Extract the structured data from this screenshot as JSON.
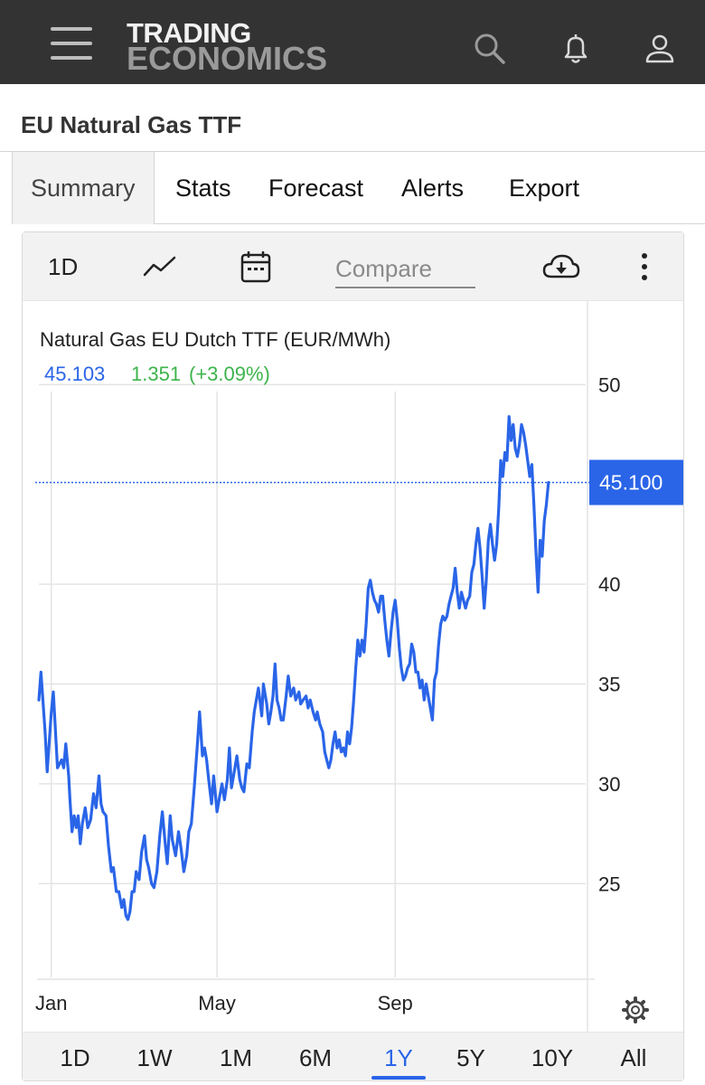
{
  "header": {
    "logo_line1": "TRADING",
    "logo_line2": "ECONOMICS",
    "icons": [
      "menu-icon",
      "search-icon",
      "bell-icon",
      "user-icon"
    ]
  },
  "page": {
    "title": "EU Natural Gas TTF"
  },
  "tabs": [
    {
      "label": "Summary",
      "active": true
    },
    {
      "label": "Stats"
    },
    {
      "label": "Forecast"
    },
    {
      "label": "Alerts"
    },
    {
      "label": "Export"
    }
  ],
  "toolbar": {
    "interval_label": "1D",
    "compare_placeholder": "Compare",
    "icons": [
      "line-chart-icon",
      "calendar-icon",
      "cloud-download-icon",
      "more-vertical-icon"
    ]
  },
  "periods": [
    {
      "label": "1D"
    },
    {
      "label": "1W"
    },
    {
      "label": "1M"
    },
    {
      "label": "6M"
    },
    {
      "label": "1Y",
      "active": true
    },
    {
      "label": "5Y"
    },
    {
      "label": "10Y"
    },
    {
      "label": "All"
    }
  ],
  "colors": {
    "line": "#2a65e8",
    "change_positive": "#3cb44b",
    "header_bg": "#333333",
    "price_badge": "#2a65e8"
  },
  "chart_data": {
    "type": "line",
    "title": "Natural Gas EU Dutch TTF (EUR/MWh)",
    "last_value": "45.103",
    "change": "1.351",
    "change_pct": "(+3.09%)",
    "price_label": "45.100",
    "price_line_value": 45.1,
    "y_ticks": [
      25,
      30,
      35,
      40,
      50
    ],
    "ylim": [
      20.3,
      50.2
    ],
    "x_ticks": [
      {
        "label": "Jan",
        "x": 0.3
      },
      {
        "label": "May",
        "x": 4.3
      },
      {
        "label": "Sep",
        "x": 8.6
      }
    ],
    "xlim": [
      0,
      13.2
    ],
    "grid": true,
    "series": [
      {
        "points": [
          [
            0.0,
            34.2
          ],
          [
            0.05,
            35.6
          ],
          [
            0.15,
            32.6
          ],
          [
            0.2,
            30.6
          ],
          [
            0.3,
            33.6
          ],
          [
            0.35,
            34.6
          ],
          [
            0.45,
            30.8
          ],
          [
            0.55,
            31.2
          ],
          [
            0.6,
            30.8
          ],
          [
            0.65,
            32.0
          ],
          [
            0.72,
            30.4
          ],
          [
            0.75,
            29.2
          ],
          [
            0.8,
            27.6
          ],
          [
            0.85,
            28.4
          ],
          [
            0.9,
            27.8
          ],
          [
            0.95,
            28.4
          ],
          [
            1.0,
            27.0
          ],
          [
            1.05,
            28.0
          ],
          [
            1.12,
            28.8
          ],
          [
            1.18,
            27.8
          ],
          [
            1.25,
            28.2
          ],
          [
            1.32,
            29.5
          ],
          [
            1.38,
            28.8
          ],
          [
            1.45,
            30.4
          ],
          [
            1.5,
            29.0
          ],
          [
            1.55,
            28.6
          ],
          [
            1.62,
            28.4
          ],
          [
            1.68,
            26.9
          ],
          [
            1.75,
            25.6
          ],
          [
            1.8,
            25.8
          ],
          [
            1.87,
            24.6
          ],
          [
            1.93,
            24.6
          ],
          [
            2.0,
            23.8
          ],
          [
            2.05,
            24.2
          ],
          [
            2.1,
            23.4
          ],
          [
            2.15,
            23.2
          ],
          [
            2.2,
            23.6
          ],
          [
            2.25,
            24.6
          ],
          [
            2.3,
            24.6
          ],
          [
            2.35,
            25.6
          ],
          [
            2.42,
            25.2
          ],
          [
            2.48,
            26.6
          ],
          [
            2.55,
            27.4
          ],
          [
            2.6,
            26.2
          ],
          [
            2.65,
            25.8
          ],
          [
            2.72,
            25.0
          ],
          [
            2.78,
            24.8
          ],
          [
            2.85,
            25.6
          ],
          [
            2.92,
            27.4
          ],
          [
            2.98,
            28.6
          ],
          [
            3.05,
            27.0
          ],
          [
            3.1,
            26.0
          ],
          [
            3.17,
            28.4
          ],
          [
            3.22,
            27.2
          ],
          [
            3.3,
            26.4
          ],
          [
            3.37,
            27.6
          ],
          [
            3.43,
            26.8
          ],
          [
            3.5,
            25.6
          ],
          [
            3.57,
            26.4
          ],
          [
            3.62,
            27.6
          ],
          [
            3.68,
            28.0
          ],
          [
            3.75,
            29.8
          ],
          [
            3.82,
            31.8
          ],
          [
            3.88,
            33.6
          ],
          [
            3.95,
            31.4
          ],
          [
            4.0,
            31.8
          ],
          [
            4.05,
            31.2
          ],
          [
            4.1,
            30.2
          ],
          [
            4.17,
            29.0
          ],
          [
            4.22,
            30.4
          ],
          [
            4.3,
            28.6
          ],
          [
            4.35,
            29.2
          ],
          [
            4.42,
            30.0
          ],
          [
            4.48,
            29.2
          ],
          [
            4.55,
            30.2
          ],
          [
            4.6,
            31.8
          ],
          [
            4.65,
            29.8
          ],
          [
            4.7,
            30.4
          ],
          [
            4.78,
            31.4
          ],
          [
            4.85,
            30.2
          ],
          [
            4.9,
            29.8
          ],
          [
            4.95,
            29.6
          ],
          [
            5.02,
            31.0
          ],
          [
            5.08,
            30.8
          ],
          [
            5.15,
            32.6
          ],
          [
            5.2,
            33.6
          ],
          [
            5.25,
            34.2
          ],
          [
            5.3,
            34.8
          ],
          [
            5.38,
            33.4
          ],
          [
            5.42,
            35.0
          ],
          [
            5.5,
            34.0
          ],
          [
            5.55,
            33.0
          ],
          [
            5.6,
            33.6
          ],
          [
            5.65,
            34.4
          ],
          [
            5.7,
            36.0
          ],
          [
            5.75,
            34.2
          ],
          [
            5.8,
            33.8
          ],
          [
            5.85,
            33.2
          ],
          [
            5.9,
            33.2
          ],
          [
            5.97,
            34.4
          ],
          [
            6.02,
            35.4
          ],
          [
            6.08,
            34.4
          ],
          [
            6.15,
            34.8
          ],
          [
            6.2,
            34.2
          ],
          [
            6.28,
            34.6
          ],
          [
            6.32,
            34.0
          ],
          [
            6.38,
            34.2
          ],
          [
            6.45,
            34.4
          ],
          [
            6.5,
            33.8
          ],
          [
            6.55,
            34.2
          ],
          [
            6.62,
            33.6
          ],
          [
            6.68,
            33.2
          ],
          [
            6.72,
            33.6
          ],
          [
            6.78,
            33.0
          ],
          [
            6.85,
            32.6
          ],
          [
            6.9,
            31.6
          ],
          [
            6.95,
            31.2
          ],
          [
            7.0,
            30.8
          ],
          [
            7.05,
            31.2
          ],
          [
            7.1,
            32.0
          ],
          [
            7.15,
            32.6
          ],
          [
            7.2,
            31.8
          ],
          [
            7.25,
            32.2
          ],
          [
            7.3,
            31.6
          ],
          [
            7.35,
            31.8
          ],
          [
            7.4,
            31.4
          ],
          [
            7.45,
            32.6
          ],
          [
            7.5,
            32.0
          ],
          [
            7.55,
            32.8
          ],
          [
            7.6,
            34.2
          ],
          [
            7.65,
            35.8
          ],
          [
            7.7,
            37.2
          ],
          [
            7.75,
            36.4
          ],
          [
            7.8,
            37.2
          ],
          [
            7.85,
            36.6
          ],
          [
            7.9,
            38.0
          ],
          [
            7.95,
            39.8
          ],
          [
            8.0,
            40.2
          ],
          [
            8.05,
            39.6
          ],
          [
            8.1,
            39.2
          ],
          [
            8.15,
            39.0
          ],
          [
            8.2,
            38.6
          ],
          [
            8.25,
            39.4
          ],
          [
            8.3,
            39.4
          ],
          [
            8.35,
            38.2
          ],
          [
            8.4,
            37.2
          ],
          [
            8.45,
            36.4
          ],
          [
            8.5,
            37.6
          ],
          [
            8.55,
            38.6
          ],
          [
            8.6,
            39.2
          ],
          [
            8.65,
            38.2
          ],
          [
            8.7,
            36.8
          ],
          [
            8.75,
            35.8
          ],
          [
            8.8,
            35.2
          ],
          [
            8.85,
            35.4
          ],
          [
            8.9,
            35.8
          ],
          [
            8.95,
            36.0
          ],
          [
            9.0,
            37.0
          ],
          [
            9.05,
            36.6
          ],
          [
            9.1,
            35.6
          ],
          [
            9.15,
            35.6
          ],
          [
            9.2,
            34.8
          ],
          [
            9.25,
            35.2
          ],
          [
            9.3,
            34.2
          ],
          [
            9.35,
            35.0
          ],
          [
            9.4,
            34.4
          ],
          [
            9.45,
            33.8
          ],
          [
            9.5,
            33.2
          ],
          [
            9.55,
            35.2
          ],
          [
            9.6,
            35.6
          ],
          [
            9.65,
            37.0
          ],
          [
            9.7,
            38.0
          ],
          [
            9.75,
            38.4
          ],
          [
            9.8,
            38.2
          ],
          [
            9.85,
            38.4
          ],
          [
            9.9,
            39.0
          ],
          [
            9.95,
            39.4
          ],
          [
            10.0,
            39.8
          ],
          [
            10.05,
            40.8
          ],
          [
            10.1,
            39.6
          ],
          [
            10.15,
            38.8
          ],
          [
            10.2,
            39.6
          ],
          [
            10.25,
            39.2
          ],
          [
            10.3,
            38.8
          ],
          [
            10.35,
            39.2
          ],
          [
            10.4,
            39.4
          ],
          [
            10.45,
            40.6
          ],
          [
            10.5,
            41.0
          ],
          [
            10.55,
            42.0
          ],
          [
            10.6,
            42.8
          ],
          [
            10.65,
            41.8
          ],
          [
            10.7,
            40.4
          ],
          [
            10.75,
            38.8
          ],
          [
            10.8,
            40.2
          ],
          [
            10.85,
            42.2
          ],
          [
            10.9,
            43.0
          ],
          [
            10.95,
            42.0
          ],
          [
            11.0,
            41.2
          ],
          [
            11.05,
            42.0
          ],
          [
            11.1,
            43.8
          ],
          [
            11.15,
            46.2
          ],
          [
            11.2,
            45.4
          ],
          [
            11.25,
            46.6
          ],
          [
            11.3,
            46.2
          ],
          [
            11.35,
            48.4
          ],
          [
            11.4,
            47.2
          ],
          [
            11.45,
            48.0
          ],
          [
            11.5,
            46.8
          ],
          [
            11.55,
            46.4
          ],
          [
            11.6,
            47.0
          ],
          [
            11.65,
            48.0
          ],
          [
            11.7,
            47.6
          ],
          [
            11.75,
            47.0
          ],
          [
            11.8,
            46.2
          ],
          [
            11.85,
            45.4
          ],
          [
            11.9,
            46.0
          ],
          [
            11.95,
            44.0
          ],
          [
            12.0,
            41.6
          ],
          [
            12.05,
            39.6
          ],
          [
            12.1,
            42.2
          ],
          [
            12.15,
            41.4
          ],
          [
            12.2,
            43.2
          ],
          [
            12.25,
            44.0
          ],
          [
            12.3,
            45.1
          ]
        ]
      }
    ]
  }
}
